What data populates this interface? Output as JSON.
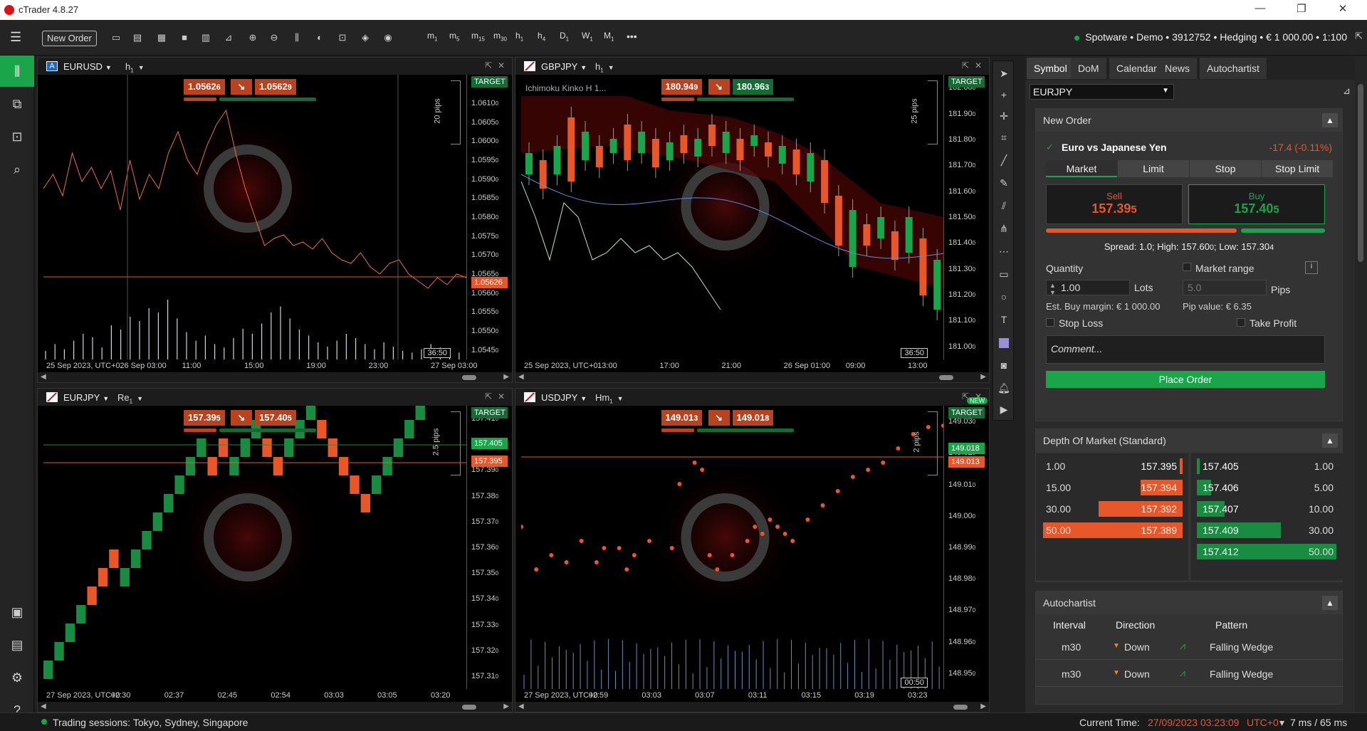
{
  "app": {
    "title": "cTrader 4.8.27"
  },
  "toolbar": {
    "new_order": "New Order",
    "timeframes": [
      {
        "b": "m",
        "s": "1"
      },
      {
        "b": "m",
        "s": "5"
      },
      {
        "b": "m",
        "s": "15"
      },
      {
        "b": "m",
        "s": "30"
      },
      {
        "b": "h",
        "s": "1"
      },
      {
        "b": "h",
        "s": "4"
      },
      {
        "b": "D",
        "s": "1"
      },
      {
        "b": "W",
        "s": "1"
      },
      {
        "b": "M",
        "s": "1"
      }
    ],
    "more": "•••",
    "account": "Spotware • Demo • 3912752 • Hedging • € 1 000.00 • 1:100"
  },
  "charts": {
    "eurusd": {
      "symbol": "EURUSD",
      "flag": "A",
      "tf": "h",
      "tfs": "1",
      "sell": "1.0562",
      "sell_s": "6",
      "buy": "1.0562",
      "buy_s": "9",
      "pips": "20 pips",
      "price_tag": "1.05626",
      "target": "TARGET",
      "timer": "36:50",
      "yticks": [
        "1.0615",
        "1.0610",
        "1.0605",
        "1.0600",
        "1.0595",
        "1.0590",
        "1.0585",
        "1.0580",
        "1.0575",
        "1.0570",
        "1.0565",
        "1.0560",
        "1.0555",
        "1.0550",
        "1.0545"
      ],
      "ysub": "0",
      "xticks": [
        "25 Sep 2023, UTC+0",
        "26 Sep 03:00",
        "11:00",
        "15:00",
        "19:00",
        "23:00",
        "27 Sep 03:00"
      ]
    },
    "gbpjpy": {
      "symbol": "GBPJPY",
      "tf": "h",
      "tfs": "1",
      "sell": "180.94",
      "sell_s": "9",
      "buy": "180.96",
      "buy_s": "3",
      "pips": "25 pips",
      "indicator": "Ichimoku Kinko H 1...",
      "target": "TARGET",
      "timer": "36:50",
      "yticks": [
        "182.00",
        "181.90",
        "181.80",
        "181.70",
        "181.60",
        "181.50",
        "181.40",
        "181.30",
        "181.20",
        "181.10",
        "181.00"
      ],
      "ysub": "0",
      "xticks": [
        "25 Sep 2023, UTC+0",
        "13:00",
        "17:00",
        "21:00",
        "26 Sep 01:00",
        "09:00",
        "13:00"
      ]
    },
    "eurjpy": {
      "symbol": "EURJPY",
      "tf": "Re",
      "tfs": "1",
      "sell": "157.39",
      "sell_s": "5",
      "buy": "157.40",
      "buy_s": "5",
      "pips": "2.5 pips",
      "tag1": "157.405",
      "tag2": "157.395",
      "target": "TARGET",
      "yticks": [
        "157.41",
        "157.40",
        "157.39",
        "157.38",
        "157.37",
        "157.36",
        "157.35",
        "157.34",
        "157.33",
        "157.32",
        "157.31"
      ],
      "ysub": "0",
      "xticks": [
        "27 Sep 2023, UTC+0",
        "02:30",
        "02:37",
        "02:45",
        "02:54",
        "03:03",
        "03:05",
        "03:20"
      ]
    },
    "usdjpy": {
      "symbol": "USDJPY",
      "tf": "Hm",
      "tfs": "1",
      "sell": "149.01",
      "sell_s": "3",
      "buy": "149.01",
      "buy_s": "8",
      "pips": "2 pips",
      "tag1": "149.018",
      "tag2": "149.013",
      "target": "TARGET",
      "new_badge": "NEW",
      "timer": "00:50",
      "yticks": [
        "149.03",
        "149.02",
        "149.01",
        "149.00",
        "148.99",
        "148.98",
        "148.97",
        "148.96",
        "148.95"
      ],
      "ysub": "0",
      "xticks": [
        "27 Sep 2023, UTC+0",
        "02:59",
        "03:03",
        "03:07",
        "03:11",
        "03:15",
        "03:19",
        "03:23"
      ]
    }
  },
  "panel": {
    "tabs": [
      "Symbol",
      "DoM",
      "Calendar",
      "News",
      "Autochartist"
    ],
    "symbol": "EURJPY",
    "new_order": {
      "title": "New Order",
      "name": "Euro vs Japanese Yen",
      "change": "-17.4 (-0.11%)",
      "order_tabs": [
        "Market",
        "Limit",
        "Stop",
        "Stop Limit"
      ],
      "sell_label": "Sell",
      "sell_price": "157.39",
      "sell_s": "5",
      "buy_label": "Buy",
      "buy_price": "157.40",
      "buy_s": "5",
      "spread": "Spread: 1.0; High: 157.60",
      "spread_s1": "0",
      "spread_low": "; Low: 157.30",
      "spread_s2": "4",
      "quantity": "Quantity",
      "qty_value": "1.00",
      "lots": "Lots",
      "market_range": "Market range",
      "mr_value": "5.0",
      "pips": "Pips",
      "margin": "Est. Buy margin: € 1 000.00",
      "pip_value": "Pip value: € 6.35",
      "stop_loss": "Stop Loss",
      "take_profit": "Take Profit",
      "comment_placeholder": "Comment...",
      "place": "Place Order"
    },
    "dom": {
      "title": "Depth Of Market (Standard)",
      "bids": [
        {
          "v": "1.00",
          "p": "157.395",
          "w": 0.02
        },
        {
          "v": "15.00",
          "p": "157.394",
          "w": 0.3
        },
        {
          "v": "30.00",
          "p": "157.392",
          "w": 0.6
        },
        {
          "v": "50.00",
          "p": "157.389",
          "w": 1.0
        }
      ],
      "asks": [
        {
          "p": "157.405",
          "v": "1.00",
          "w": 0.02
        },
        {
          "p": "157.406",
          "v": "5.00",
          "w": 0.1
        },
        {
          "p": "157.407",
          "v": "10.00",
          "w": 0.2
        },
        {
          "p": "157.409",
          "v": "30.00",
          "w": 0.6
        },
        {
          "p": "157.412",
          "v": "50.00",
          "w": 1.0
        }
      ]
    },
    "autochartist": {
      "title": "Autochartist",
      "cols": [
        "Interval",
        "Direction",
        "Pattern"
      ],
      "rows": [
        {
          "i": "m30",
          "d": "Down",
          "p": "Falling Wedge"
        },
        {
          "i": "m30",
          "d": "Down",
          "p": "Falling Wedge"
        }
      ]
    }
  },
  "status": {
    "sessions": "Trading sessions: Tokyo, Sydney, Singapore",
    "time_label": "Current Time:",
    "time": "27/09/2023 03:23:09",
    "tz": "UTC+0",
    "latency": "7 ms / 65 ms"
  },
  "colors": {
    "sell": "#e8572a",
    "buy": "#1aa54b",
    "bg": "#000000"
  }
}
